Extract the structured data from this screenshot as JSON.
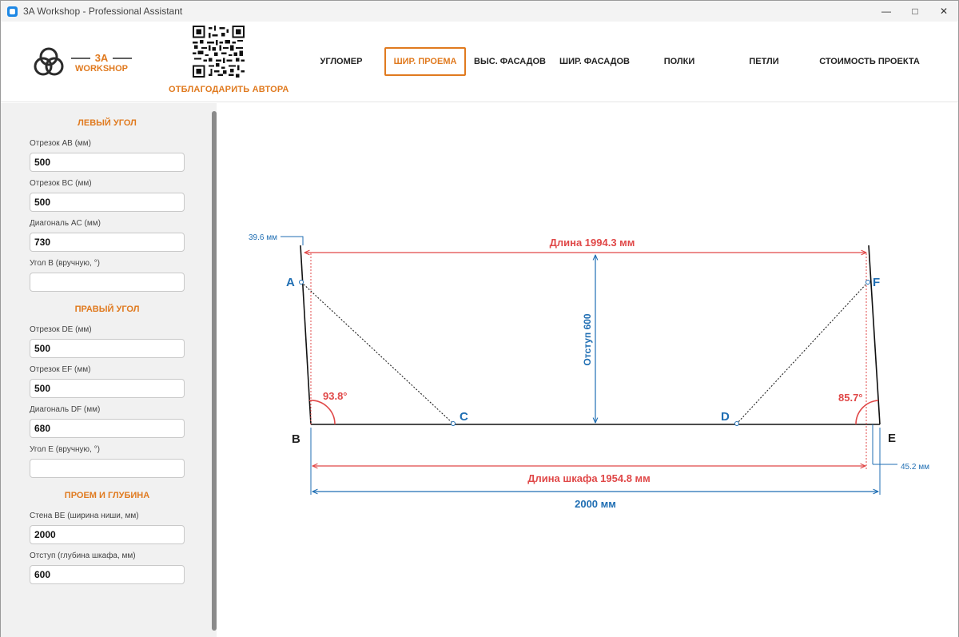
{
  "window": {
    "title": "3A Workshop - Professional Assistant"
  },
  "header": {
    "logo_text_top": "3A",
    "logo_text_bottom": "WORKSHOP",
    "donate_label": "ОТБЛАГОДАРИТЬ АВТОРА",
    "tabs": [
      {
        "label": "УГЛОМЕР"
      },
      {
        "label": "ШИР. ПРОЕМА",
        "active": true
      },
      {
        "label": "ВЫС. ФАСАДОВ"
      },
      {
        "label": "ШИР. ФАСАДОВ"
      },
      {
        "label": "ПОЛКИ"
      },
      {
        "label": "ПЕТЛИ"
      },
      {
        "label": "СТОИМОСТЬ ПРОЕКТА"
      }
    ]
  },
  "sidebar": {
    "left_corner": {
      "title": "ЛЕВЫЙ УГОЛ",
      "ab_label": "Отрезок AB (мм)",
      "ab_value": "500",
      "bc_label": "Отрезок BC (мм)",
      "bc_value": "500",
      "ac_label": "Диагональ AC (мм)",
      "ac_value": "730",
      "angle_b_label": "Угол B (вручную, °)",
      "angle_b_value": ""
    },
    "right_corner": {
      "title": "ПРАВЫЙ УГОЛ",
      "de_label": "Отрезок DE (мм)",
      "de_value": "500",
      "ef_label": "Отрезок EF (мм)",
      "ef_value": "500",
      "df_label": "Диагональ DF (мм)",
      "df_value": "680",
      "angle_e_label": "Угол E (вручную, °)",
      "angle_e_value": ""
    },
    "opening": {
      "title": "ПРОЕМ И ГЛУБИНА",
      "wall_label": "Стена BE (ширина ниши, мм)",
      "wall_value": "2000",
      "offset_label": "Отступ (глубина шкафа, мм)",
      "offset_value": "600"
    }
  },
  "drawing": {
    "points": {
      "a": "A",
      "b": "B",
      "c": "C",
      "d": "D",
      "e": "E",
      "f": "F"
    },
    "left_offset": "39.6 мм",
    "right_offset": "45.2 мм",
    "top_length": "Длина 1994.3 мм",
    "depth": "Отступ 600",
    "angle_b": "93.8°",
    "angle_e": "85.7°",
    "cabinet_length": "Длина шкафа 1954.8 мм",
    "wall_length": "2000 мм",
    "colors": {
      "red": "#e04848",
      "blue": "#1f6eb3",
      "orange": "#e07a1f"
    }
  }
}
